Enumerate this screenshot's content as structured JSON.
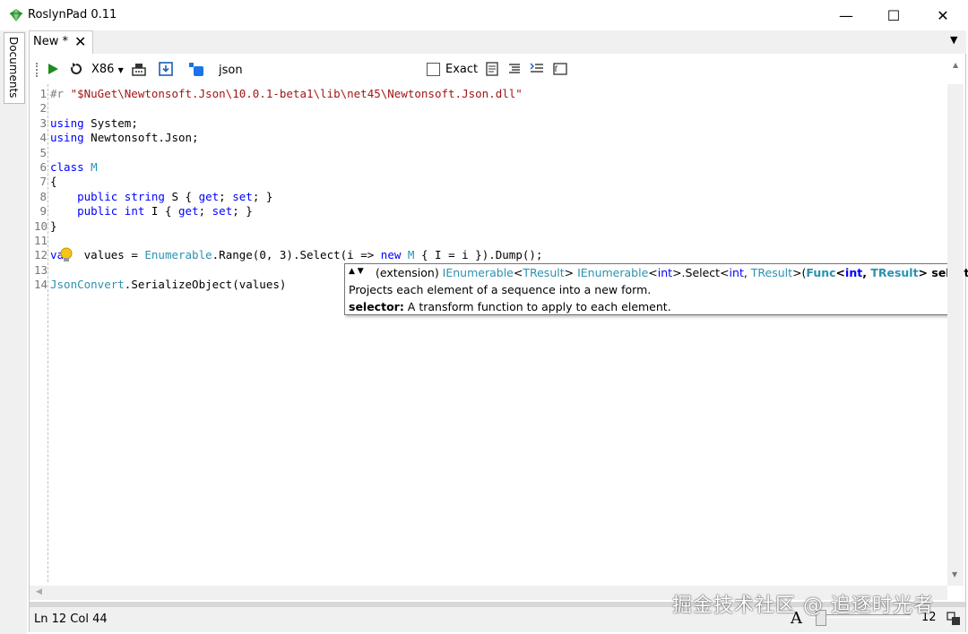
{
  "window": {
    "title": "RoslynPad 0.11",
    "controls": {
      "minimize": "—",
      "maximize": "☐",
      "close": "✕"
    }
  },
  "side_dock": {
    "documents_label": "Documents"
  },
  "tabs": [
    {
      "label": "New *",
      "close": "✕"
    }
  ],
  "tab_overflow_icon": "▼",
  "toolbar": {
    "platform": "X86",
    "search_value": "json",
    "exact_label": "Exact",
    "icons": [
      "grip-icon",
      "run-icon",
      "restart-icon",
      "platform-dropdown-icon",
      "nuget-icon",
      "save-icon",
      "package-icon",
      "format-icon",
      "comment-icon",
      "uncomment-icon",
      "console-icon"
    ]
  },
  "code": {
    "lines": [
      {
        "n": "1",
        "segments": [
          {
            "cls": "pp",
            "t": "#r "
          },
          {
            "cls": "str",
            "t": "\"$NuGet\\Newtonsoft.Json\\10.0.1-beta1\\lib\\net45\\Newtonsoft.Json.dll\""
          }
        ]
      },
      {
        "n": "2",
        "segments": []
      },
      {
        "n": "3",
        "segments": [
          {
            "cls": "kw",
            "t": "using"
          },
          {
            "cls": "",
            "t": " System;"
          }
        ]
      },
      {
        "n": "4",
        "segments": [
          {
            "cls": "kw",
            "t": "using"
          },
          {
            "cls": "",
            "t": " Newtonsoft.Json;"
          }
        ]
      },
      {
        "n": "5",
        "segments": []
      },
      {
        "n": "6",
        "segments": [
          {
            "cls": "kw",
            "t": "class"
          },
          {
            "cls": "",
            "t": " "
          },
          {
            "cls": "ty",
            "t": "M"
          }
        ]
      },
      {
        "n": "7",
        "segments": [
          {
            "cls": "",
            "t": "{"
          }
        ]
      },
      {
        "n": "8",
        "segments": [
          {
            "cls": "",
            "t": "    "
          },
          {
            "cls": "kw",
            "t": "public"
          },
          {
            "cls": "",
            "t": " "
          },
          {
            "cls": "kw",
            "t": "string"
          },
          {
            "cls": "",
            "t": " S { "
          },
          {
            "cls": "kw",
            "t": "get"
          },
          {
            "cls": "",
            "t": "; "
          },
          {
            "cls": "kw",
            "t": "set"
          },
          {
            "cls": "",
            "t": "; }"
          }
        ]
      },
      {
        "n": "9",
        "segments": [
          {
            "cls": "",
            "t": "    "
          },
          {
            "cls": "kw",
            "t": "public"
          },
          {
            "cls": "",
            "t": " "
          },
          {
            "cls": "kw",
            "t": "int"
          },
          {
            "cls": "",
            "t": " I { "
          },
          {
            "cls": "kw",
            "t": "get"
          },
          {
            "cls": "",
            "t": "; "
          },
          {
            "cls": "kw",
            "t": "set"
          },
          {
            "cls": "",
            "t": "; }"
          }
        ]
      },
      {
        "n": "10",
        "segments": [
          {
            "cls": "",
            "t": "}"
          }
        ]
      },
      {
        "n": "11",
        "segments": []
      },
      {
        "n": "12",
        "segments": [
          {
            "cls": "kw",
            "t": "va"
          },
          {
            "cls": "",
            "t": "   values = "
          },
          {
            "cls": "ty",
            "t": "Enumerable"
          },
          {
            "cls": "",
            "t": ".Range(0, 3).Select(i => "
          },
          {
            "cls": "kw",
            "t": "new"
          },
          {
            "cls": "",
            "t": " "
          },
          {
            "cls": "ty",
            "t": "M"
          },
          {
            "cls": "",
            "t": " { I = i }).Dump();"
          }
        ]
      },
      {
        "n": "13",
        "segments": []
      },
      {
        "n": "14",
        "segments": [
          {
            "cls": "ty",
            "t": "JsonConvert"
          },
          {
            "cls": "",
            "t": ".SerializeObject(values)"
          }
        ]
      }
    ]
  },
  "tooltip": {
    "arrows": "▲ ▼",
    "signature": [
      {
        "cls": "",
        "t": "(extension) "
      },
      {
        "cls": "tt-t",
        "t": "IEnumerable"
      },
      {
        "cls": "",
        "t": "<"
      },
      {
        "cls": "tt-t",
        "t": "TResult"
      },
      {
        "cls": "",
        "t": "> "
      },
      {
        "cls": "tt-t",
        "t": "IEnumerable"
      },
      {
        "cls": "",
        "t": "<"
      },
      {
        "cls": "tt-kw",
        "t": "int"
      },
      {
        "cls": "",
        "t": ">.Select<"
      },
      {
        "cls": "tt-kw",
        "t": "int"
      },
      {
        "cls": "",
        "t": ", "
      },
      {
        "cls": "tt-t",
        "t": "TResult"
      },
      {
        "cls": "",
        "t": ">("
      },
      {
        "cls": "tt-tb",
        "t": "Func"
      },
      {
        "cls": "tt-b",
        "t": "<"
      },
      {
        "cls": "tt-kb",
        "t": "int"
      },
      {
        "cls": "tt-b",
        "t": ", "
      },
      {
        "cls": "tt-tb",
        "t": "TResult"
      },
      {
        "cls": "tt-b",
        "t": "> selector"
      },
      {
        "cls": "",
        "t": ")"
      }
    ],
    "description": "Projects each element of a sequence into a new form.",
    "param_name": "selector:",
    "param_desc": " A transform function to apply to each element."
  },
  "status": {
    "position": "Ln 12 Col 44",
    "font_icon": "A",
    "zoom_value": "12",
    "zoom_level": 12
  },
  "watermark": "掘金技术社区 @ 追逐时光者",
  "colors": {
    "keyword": "#0000ff",
    "type": "#2b91af",
    "string": "#a31515",
    "accent_green": "#1e8c1e"
  }
}
